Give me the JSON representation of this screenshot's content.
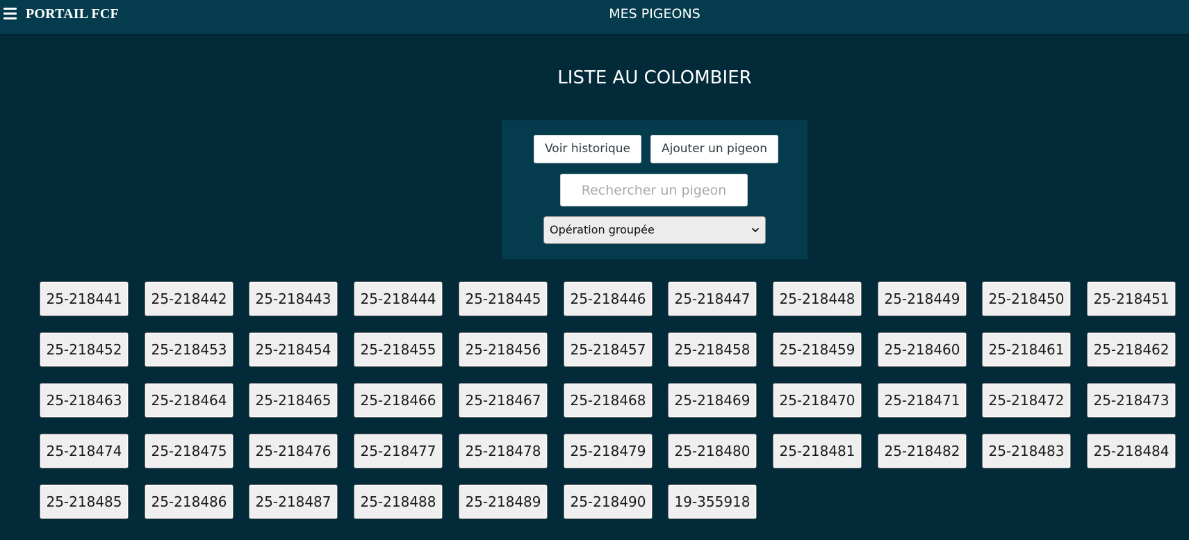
{
  "topbar": {
    "brand": "PORTAIL FCF",
    "heading": "MES PIGEONS",
    "menu_icon": "hamburger-menu-icon"
  },
  "main": {
    "title": "LISTE AU COLOMBIER",
    "actions": {
      "history_label": "Voir historique",
      "add_label": "Ajouter un pigeon"
    },
    "search": {
      "placeholder": "Rechercher un pigeon",
      "value": ""
    },
    "bulk_select": {
      "selected": "Opération groupée",
      "icon": "chevron-down-icon"
    }
  },
  "pigeons": [
    "25-218441",
    "25-218442",
    "25-218443",
    "25-218444",
    "25-218445",
    "25-218446",
    "25-218447",
    "25-218448",
    "25-218449",
    "25-218450",
    "25-218451",
    "25-218452",
    "25-218453",
    "25-218454",
    "25-218455",
    "25-218456",
    "25-218457",
    "25-218458",
    "25-218459",
    "25-218460",
    "25-218461",
    "25-218462",
    "25-218463",
    "25-218464",
    "25-218465",
    "25-218466",
    "25-218467",
    "25-218468",
    "25-218469",
    "25-218470",
    "25-218471",
    "25-218472",
    "25-218473",
    "25-218474",
    "25-218475",
    "25-218476",
    "25-218477",
    "25-218478",
    "25-218479",
    "25-218480",
    "25-218481",
    "25-218482",
    "25-218483",
    "25-218484",
    "25-218485",
    "25-218486",
    "25-218487",
    "25-218488",
    "25-218489",
    "25-218490",
    "19-355918"
  ],
  "colors": {
    "background": "#032a38",
    "topbar": "#043c4d",
    "panel": "#043c4d",
    "pigeon_button": "#efefef"
  }
}
